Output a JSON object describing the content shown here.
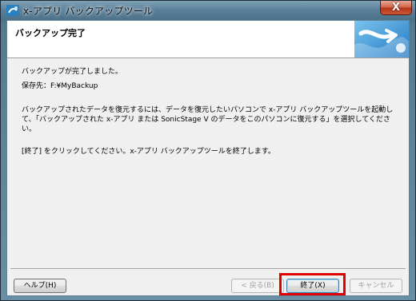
{
  "window": {
    "title": "x-アプリ バックアップツール",
    "close_label": "X"
  },
  "header": {
    "title": "バックアップ完了"
  },
  "body": {
    "line1": "バックアップが完了しました。",
    "line2": "保存先：F:¥MyBackup",
    "para1a": "バックアップされたデータを復元するには、データを復元したいパソコンで x-アプリ バックアップツールを起動し",
    "para1b": "て、「バックアップされた x-アプリ または SonicStage V のデータをこのパソコンに復元する」を選択してくださ",
    "para1c": "い。",
    "para2": "[終了] をクリックしてください。x-アプリ バックアップツールを終了します。"
  },
  "buttons": {
    "help": "ヘルプ(H)",
    "back": "< 戻る(B)",
    "finish": "終了(X)",
    "cancel": "キャンセル"
  },
  "colors": {
    "highlight": "#e00000",
    "header_graphic": "#2a8fd0"
  }
}
